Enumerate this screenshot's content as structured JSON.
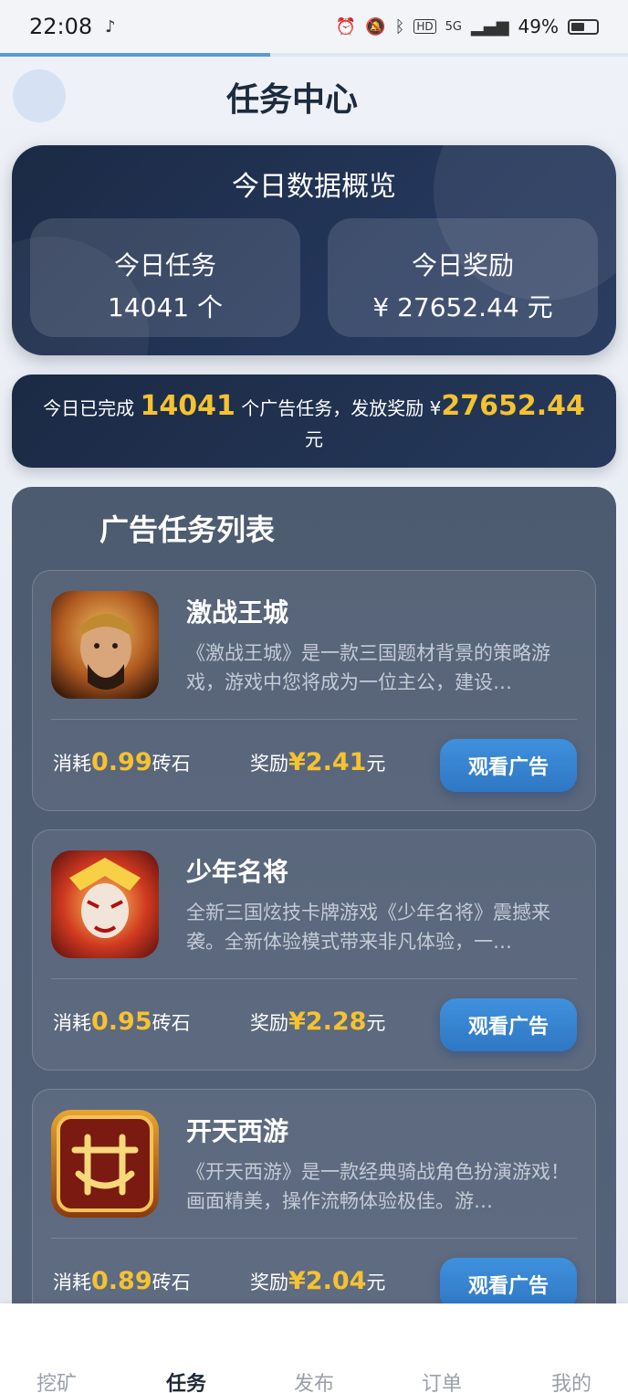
{
  "status_bar": {
    "time": "22:08",
    "battery": "49%",
    "network": "5G"
  },
  "page": {
    "title": "任务中心"
  },
  "overview": {
    "title": "今日数据概览",
    "tasks_label": "今日任务",
    "tasks_value": "14041 个",
    "reward_label": "今日奖励",
    "reward_value": "¥ 27652.44 元"
  },
  "banner": {
    "prefix": "今日已完成",
    "count": "14041",
    "middle": "个广告任务，发放奖励",
    "currency": "¥",
    "amount": "27652.44",
    "suffix": "元"
  },
  "task_list": {
    "title": "广告任务列表",
    "cost_label": "消耗",
    "cost_unit": "砖石",
    "reward_label": "奖励",
    "reward_unit": "元",
    "button_label": "观看广告",
    "items": [
      {
        "name": "激战王城",
        "desc": "《激战王城》是一款三国题材背景的策略游戏，游戏中您将成为一位主公，建设…",
        "cost": "0.99",
        "reward": "¥2.41"
      },
      {
        "name": "少年名将",
        "desc": "全新三国炫技卡牌游戏《少年名将》震撼来袭。全新体验模式带来非凡体验，一…",
        "cost": "0.95",
        "reward": "¥2.28"
      },
      {
        "name": "开天西游",
        "desc": "《开天西游》是一款经典骑战角色扮演游戏！画面精美，操作流畅体验极佳。游…",
        "cost": "0.89",
        "reward": "¥2.04"
      }
    ]
  },
  "bottom_nav": {
    "items": [
      "挖矿",
      "任务",
      "发布",
      "订单",
      "我的"
    ],
    "active": "任务"
  }
}
